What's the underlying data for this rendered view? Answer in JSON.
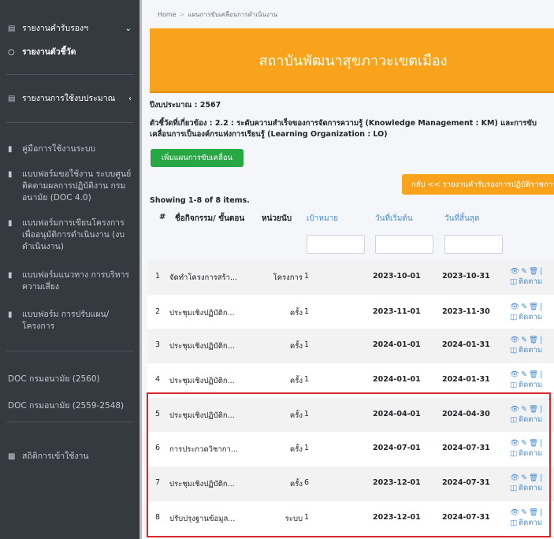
{
  "sidebar": {
    "items": [
      {
        "label": "รายงานคำรับรองฯ",
        "icon": "file-icon"
      },
      {
        "label": "รายงานตัวชี้วัด",
        "icon": "circle-icon"
      },
      {
        "label": "รายงานการใช้งบประมาณ",
        "icon": "file-icon"
      },
      {
        "label": "คู่มือการใช้งานระบบ",
        "icon": "book-icon"
      },
      {
        "label": "แบบฟอร์มขอใช้งาน ระบบศูนย์ติดตามผลการปฏิบัติงาน กรมอนามัย (DOC 4.0)",
        "icon": "book-icon"
      },
      {
        "label": "แบบฟอร์มการเขียนโครงการ เพื่ออนุมัติการดำเนินงาน (งบดำเนินงาน)",
        "icon": "book-icon"
      },
      {
        "label": "แบบฟอร์มแนวทาง การบริหารความเสี่ยง",
        "icon": "book-icon"
      },
      {
        "label": "แบบฟอร์ม การปรับแผน/โครงการ",
        "icon": "book-icon"
      },
      {
        "label": "DOC กรมอนามัย (2560)"
      },
      {
        "label": "DOC กรมอนามัย (2559-2548)"
      },
      {
        "label": "สถิติการเข้าใช้งาน",
        "icon": "chart-icon"
      }
    ]
  },
  "breadcrumb": {
    "home": "Home",
    "current": "แผนการขับเคลื่อนการดำเนินงาน"
  },
  "banner": {
    "title": "สถาบันพัฒนาสุขภาวะเขตเมือง",
    "color": "#f8a31b"
  },
  "info": {
    "budget_year": "ปีงบประมาณ : 2567",
    "indicator_line1": "ตัวชี้วัดที่เกี่ยวข้อง : 2.2 : ระดับความสำเร็จของการจัดการความรู้ (Knowledge Management : KM) และการขับ",
    "indicator_line2": "เคลื่อนการเป็นองค์กรแห่งการเรียนรู้ (Learning Organization : LO)"
  },
  "buttons": {
    "add_plan": "เพิ่มแผนการขับเคลื่อน",
    "back": "กลับ << รายงานคำรับรองการปฏิบัติราชการ"
  },
  "showing": "Showing 1-8 of 8 items.",
  "table": {
    "headers": {
      "num": "#",
      "activity": "ชื่อกิจกรรม/ ขั้นตอน",
      "unit": "หน่วยนับ",
      "target": "เป้าหมาย",
      "start": "วันที่เริ่มต้น",
      "end": "วันที่สิ้นสุด"
    },
    "follow_label": "ติดตาม",
    "rows": [
      {
        "num": "1",
        "activity": "จัดทำโครงการสร้า...",
        "unit": "โครงการ",
        "target": "1",
        "start": "2023-10-01",
        "end": "2023-10-31"
      },
      {
        "num": "2",
        "activity": "ประชุมเชิงปฏิบัติก...",
        "unit": "ครั้ง",
        "target": "1",
        "start": "2023-11-01",
        "end": "2023-11-30"
      },
      {
        "num": "3",
        "activity": "ประชุมเชิงปฏิบัติก...",
        "unit": "ครั้ง",
        "target": "1",
        "start": "2024-01-01",
        "end": "2024-01-31"
      },
      {
        "num": "4",
        "activity": "ประชุมเชิงปฏิบัติก...",
        "unit": "ครั้ง",
        "target": "1",
        "start": "2024-01-01",
        "end": "2024-01-31"
      },
      {
        "num": "5",
        "activity": "ประชุมเชิงปฏิบัติก...",
        "unit": "ครั้ง",
        "target": "1",
        "start": "2024-04-01",
        "end": "2024-04-30"
      },
      {
        "num": "6",
        "activity": "การประกวดวิชากา...",
        "unit": "ครั้ง",
        "target": "1",
        "start": "2024-07-01",
        "end": "2024-07-31"
      },
      {
        "num": "7",
        "activity": "ประชุมเชิงปฏิบัติก...",
        "unit": "ครั้ง",
        "target": "6",
        "start": "2023-12-01",
        "end": "2024-07-31"
      },
      {
        "num": "8",
        "activity": "ปรับปรุงฐานข้อมูล...",
        "unit": "ระบบ",
        "target": "1",
        "start": "2023-12-01",
        "end": "2024-07-31"
      }
    ]
  }
}
